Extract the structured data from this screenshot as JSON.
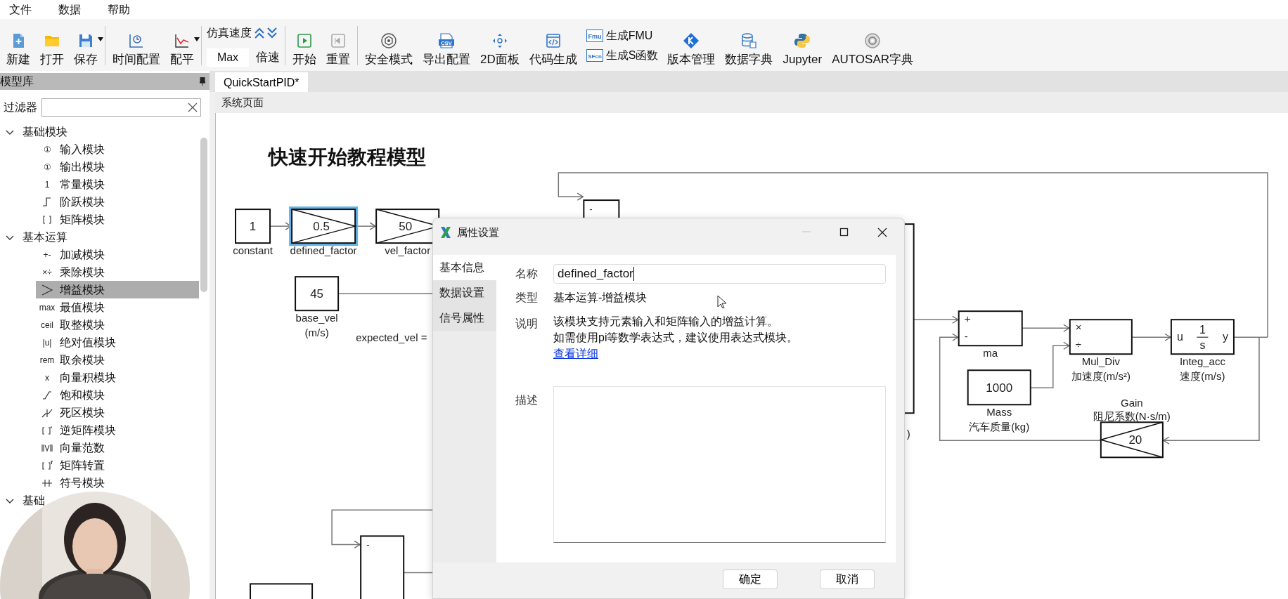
{
  "menu": [
    {
      "label": "文件"
    },
    {
      "label": "数据"
    },
    {
      "label": "帮助"
    }
  ],
  "toolbar": [
    {
      "kind": "button",
      "label": "新建"
    },
    {
      "kind": "button",
      "label": "打开"
    },
    {
      "kind": "dropdown",
      "label": "保存"
    },
    {
      "kind": "separator"
    },
    {
      "kind": "button",
      "label": "时间配置"
    },
    {
      "kind": "dropdown",
      "label": "配平"
    },
    {
      "kind": "separator"
    },
    {
      "kind": "speed",
      "label": "仿真速度",
      "value": "Max",
      "button": "倍速"
    },
    {
      "kind": "separator"
    },
    {
      "kind": "button",
      "label": "开始"
    },
    {
      "kind": "button",
      "label": "重置"
    },
    {
      "kind": "separator"
    },
    {
      "kind": "button",
      "label": "安全模式"
    },
    {
      "kind": "button",
      "label": "导出配置",
      "icon_text": "CSV"
    },
    {
      "kind": "button",
      "label": "2D面板"
    },
    {
      "kind": "button",
      "label": "代码生成"
    },
    {
      "kind": "stack",
      "items": [
        {
          "label": "生成FMU",
          "icon_text": "Fmu"
        },
        {
          "label": "生成S函数",
          "icon_text": "SFcn"
        }
      ]
    },
    {
      "kind": "button",
      "label": "版本管理"
    },
    {
      "kind": "button",
      "label": "数据字典"
    },
    {
      "kind": "button",
      "label": "Jupyter"
    },
    {
      "kind": "button",
      "label": "AUTOSAR字典"
    }
  ],
  "library": {
    "title": "模型库",
    "filter": {
      "label": "过滤器"
    },
    "tree": [
      {
        "label": "基础模块",
        "expanded": true,
        "children": [
          {
            "label": "输入模块",
            "kind": "text",
            "symbol": "①",
            "selected": false
          },
          {
            "label": "输出模块",
            "kind": "text",
            "symbol": "①",
            "selected": false
          },
          {
            "label": "常量模块",
            "kind": "text",
            "symbol": "1",
            "selected": false
          },
          {
            "label": "阶跃模块",
            "kind": "step",
            "selected": false
          },
          {
            "label": "矩阵模块",
            "kind": "matrix",
            "selected": false
          }
        ]
      },
      {
        "label": "基本运算",
        "expanded": true,
        "children": [
          {
            "label": "加减模块",
            "kind": "text",
            "symbol": "+-",
            "selected": false
          },
          {
            "label": "乘除模块",
            "kind": "text",
            "symbol": "×÷",
            "selected": false
          },
          {
            "label": "增益模块",
            "kind": "gain",
            "selected": true
          },
          {
            "label": "最值模块",
            "kind": "text",
            "symbol": "max",
            "selected": false
          },
          {
            "label": "取整模块",
            "kind": "text",
            "symbol": "ceil",
            "selected": false
          },
          {
            "label": "绝对值模块",
            "kind": "text",
            "symbol": "|u|",
            "selected": false
          },
          {
            "label": "取余模块",
            "kind": "text",
            "symbol": "rem",
            "selected": false
          },
          {
            "label": "向量积模块",
            "kind": "text",
            "symbol": "x",
            "selected": false
          },
          {
            "label": "饱和模块",
            "kind": "saturation",
            "selected": false
          },
          {
            "label": "死区模块",
            "kind": "deadzone",
            "selected": false
          },
          {
            "label": "逆矩阵模块",
            "kind": "inverse",
            "selected": false
          },
          {
            "label": "向量范数",
            "kind": "norm",
            "selected": false
          },
          {
            "label": "矩阵转置",
            "kind": "transpose",
            "selected": false
          },
          {
            "label": "符号模块",
            "kind": "sign",
            "selected": false
          }
        ]
      },
      {
        "label": "基础",
        "expanded": true
      }
    ]
  },
  "tabs": [
    {
      "label": "QuickStartPID*",
      "selected": true
    }
  ],
  "page_title": "系统页面",
  "diagram": {
    "title": "快速开始教程模型",
    "blocks": [
      {
        "kind": "constant",
        "value": "1",
        "labels": [
          "constant"
        ],
        "selected": false
      },
      {
        "kind": "gain",
        "value": "0.5",
        "labels": [
          "defined_factor"
        ],
        "selected": true
      },
      {
        "kind": "gain",
        "value": "50",
        "labels": [
          "vel_factor"
        ],
        "selected": false
      },
      {
        "kind": "constant",
        "value": "45",
        "labels": [
          "base_vel",
          "(m/s)"
        ],
        "selected": false
      },
      {
        "kind": "sum",
        "signs": [
          "-"
        ],
        "selected": false
      },
      {
        "kind": "plain",
        "selected": false
      },
      {
        "kind": "sum",
        "signs": [
          "+",
          "-"
        ],
        "labels": [
          "ma"
        ],
        "selected": false
      },
      {
        "kind": "sum",
        "signs": [
          "×",
          "÷"
        ],
        "labels": [
          "Mul_Div",
          "加速度(m/s²)"
        ],
        "selected": false
      },
      {
        "kind": "integrator",
        "input": "u",
        "output": "y",
        "numerator": "1",
        "denominator": "s",
        "labels": [
          "Integ_acc",
          "速度(m/s)"
        ],
        "selected": false
      },
      {
        "kind": "constant",
        "value": "1000",
        "labels": [
          "Mass",
          "汽车质量(kg)"
        ],
        "selected": false
      },
      {
        "kind": "gain_left",
        "value": "20",
        "labels": [
          "Gain",
          "阻尼系数(N·s/m)"
        ],
        "selected": false
      },
      {
        "kind": "sum",
        "signs": [
          "-"
        ],
        "selected": false
      },
      {
        "kind": "plain",
        "selected": false
      }
    ],
    "notes": [
      "expected_vel =",
      ")"
    ]
  },
  "dialog": {
    "title": "属性设置",
    "nav": [
      {
        "label": "基本信息",
        "selected": true
      },
      {
        "label": "数据设置",
        "selected": false
      },
      {
        "label": "信号属性",
        "selected": false
      }
    ],
    "fields": [
      {
        "kind": "input",
        "label": "名称",
        "value": "defined_factor"
      },
      {
        "kind": "text",
        "label": "类型",
        "value": "基本运算-增益模块"
      },
      {
        "kind": "note",
        "label": "说明",
        "lines": [
          "该模块支持元素输入和矩阵输入的增益计算。",
          "如需使用pi等数学表达式，建议使用表达式模块。"
        ],
        "link": "查看详细"
      },
      {
        "kind": "textarea",
        "label": "描述"
      }
    ],
    "buttons": [
      "确定",
      "取消"
    ]
  }
}
